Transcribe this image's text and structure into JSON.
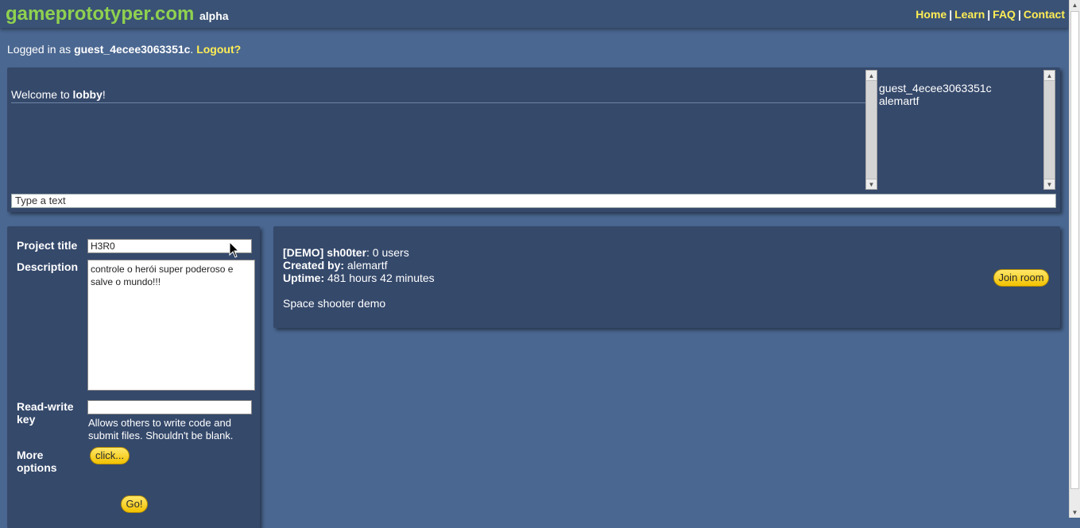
{
  "header": {
    "brand": "gameprototyper.com",
    "brand_tag": "alpha",
    "nav": [
      {
        "label": "Home"
      },
      {
        "label": "Learn"
      },
      {
        "label": "FAQ"
      },
      {
        "label": "Contact"
      }
    ],
    "separator": "|"
  },
  "session": {
    "prefix": "Logged in as ",
    "username": "guest_4ecee3063351c",
    "suffix": ". ",
    "logout_label": "Logout?"
  },
  "chat": {
    "welcome_prefix": "Welcome to ",
    "room_name": "lobby",
    "welcome_suffix": "!",
    "users": [
      "guest_4ecee3063351c",
      "alemartf"
    ],
    "input_value": "Type a text"
  },
  "project_form": {
    "title_label": "Project title",
    "title_value": "H3R0",
    "description_label": "Description",
    "description_value": "controle o herói super poderoso e salve o mundo!!!",
    "rw_key_label": "Read-write key",
    "rw_key_value": "",
    "rw_key_hint": "Allows others to write code and submit files. Shouldn't be blank.",
    "more_options_label": "More options",
    "more_options_button": "click...",
    "go_button": "Go!"
  },
  "room": {
    "name": "[DEMO] sh00ter",
    "users_text": ": 0 users",
    "created_by_label": "Created by:",
    "created_by": " alemartf",
    "uptime_label": "Uptime:",
    "uptime": " 481 hours 42 minutes",
    "description": "Space shooter demo",
    "join_button": "Join room"
  },
  "icons": {
    "scroll_up": "scroll-up-arrow-icon",
    "scroll_down": "scroll-down-arrow-icon",
    "cursor": "mouse-pointer-icon"
  },
  "colors": {
    "background": "#4a6791",
    "panel": "#35496b",
    "brand": "#8fd14f",
    "link": "#ffee55",
    "button": "#f2c200"
  }
}
